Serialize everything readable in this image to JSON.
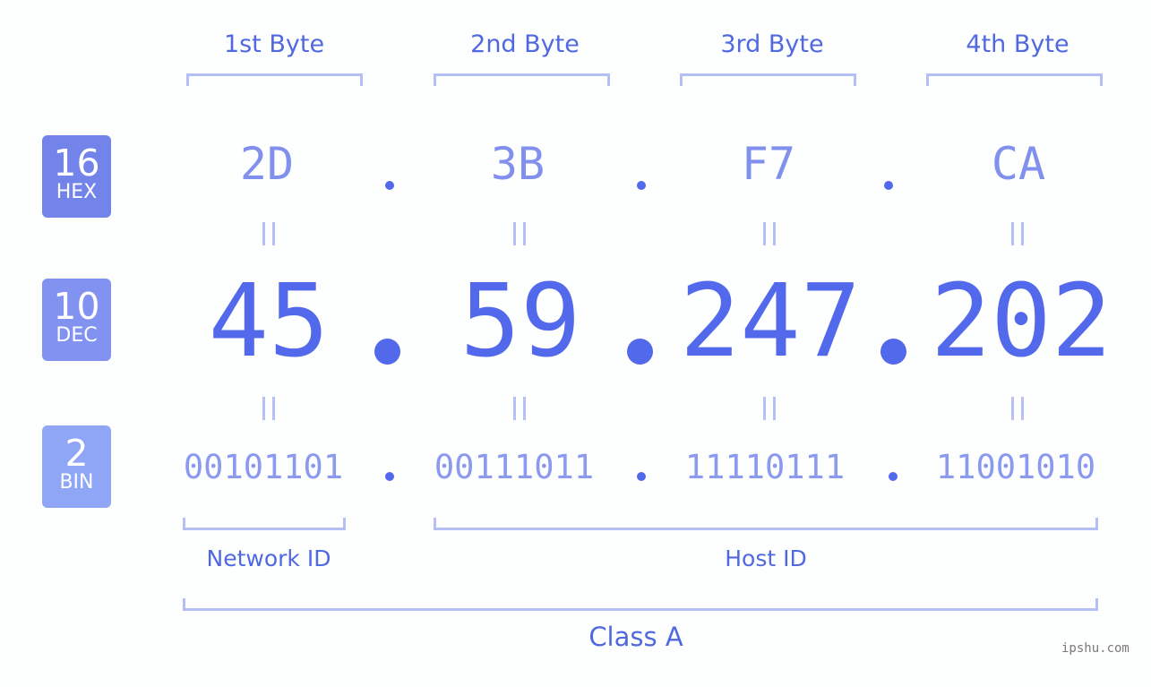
{
  "bytes": [
    {
      "label": "1st Byte",
      "hex": "2D",
      "dec": "45",
      "bin": "00101101"
    },
    {
      "label": "2nd Byte",
      "hex": "3B",
      "dec": "59",
      "bin": "00111011"
    },
    {
      "label": "3rd Byte",
      "hex": "F7",
      "dec": "247",
      "bin": "11110111"
    },
    {
      "label": "4th Byte",
      "hex": "CA",
      "dec": "202",
      "bin": "11001010"
    }
  ],
  "badges": {
    "hex": {
      "num": "16",
      "base": "HEX",
      "color": "#7283ea"
    },
    "dec": {
      "num": "10",
      "base": "DEC",
      "color": "#8292f0"
    },
    "bin": {
      "num": "2",
      "base": "BIN",
      "color": "#8fa5f6"
    }
  },
  "separator": ".",
  "network_id_label": "Network ID",
  "host_id_label": "Host ID",
  "class_label": "Class A",
  "watermark": "ipshu.com",
  "colors": {
    "accent": "#5369ec",
    "bracket": "#b4bff6",
    "label": "#5068e0"
  }
}
